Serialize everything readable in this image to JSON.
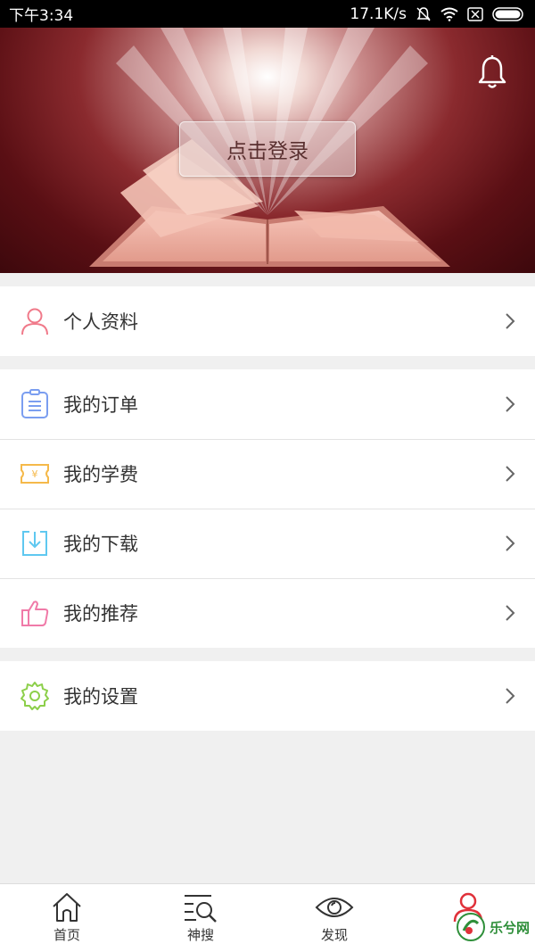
{
  "status_bar": {
    "time": "下午3:34",
    "speed": "17.1K/s"
  },
  "banner": {
    "login_label": "点击登录"
  },
  "menu": {
    "profile": {
      "label": "个人资料",
      "icon": "person-icon",
      "color": "#f07a8a"
    },
    "orders": {
      "label": "我的订单",
      "icon": "clipboard-icon",
      "color": "#7b9ef0"
    },
    "tuition": {
      "label": "我的学费",
      "icon": "ticket-icon",
      "color": "#f5b94a"
    },
    "downloads": {
      "label": "我的下载",
      "icon": "download-icon",
      "color": "#5fc8f0"
    },
    "recommend": {
      "label": "我的推荐",
      "icon": "thumbs-up-icon",
      "color": "#f07aa8"
    },
    "settings": {
      "label": "我的设置",
      "icon": "gear-icon",
      "color": "#8ccf4a"
    }
  },
  "bottom_nav": {
    "home": "首页",
    "search": "神搜",
    "discover": "发现",
    "me": ""
  },
  "watermark": {
    "text": "乐兮网"
  }
}
